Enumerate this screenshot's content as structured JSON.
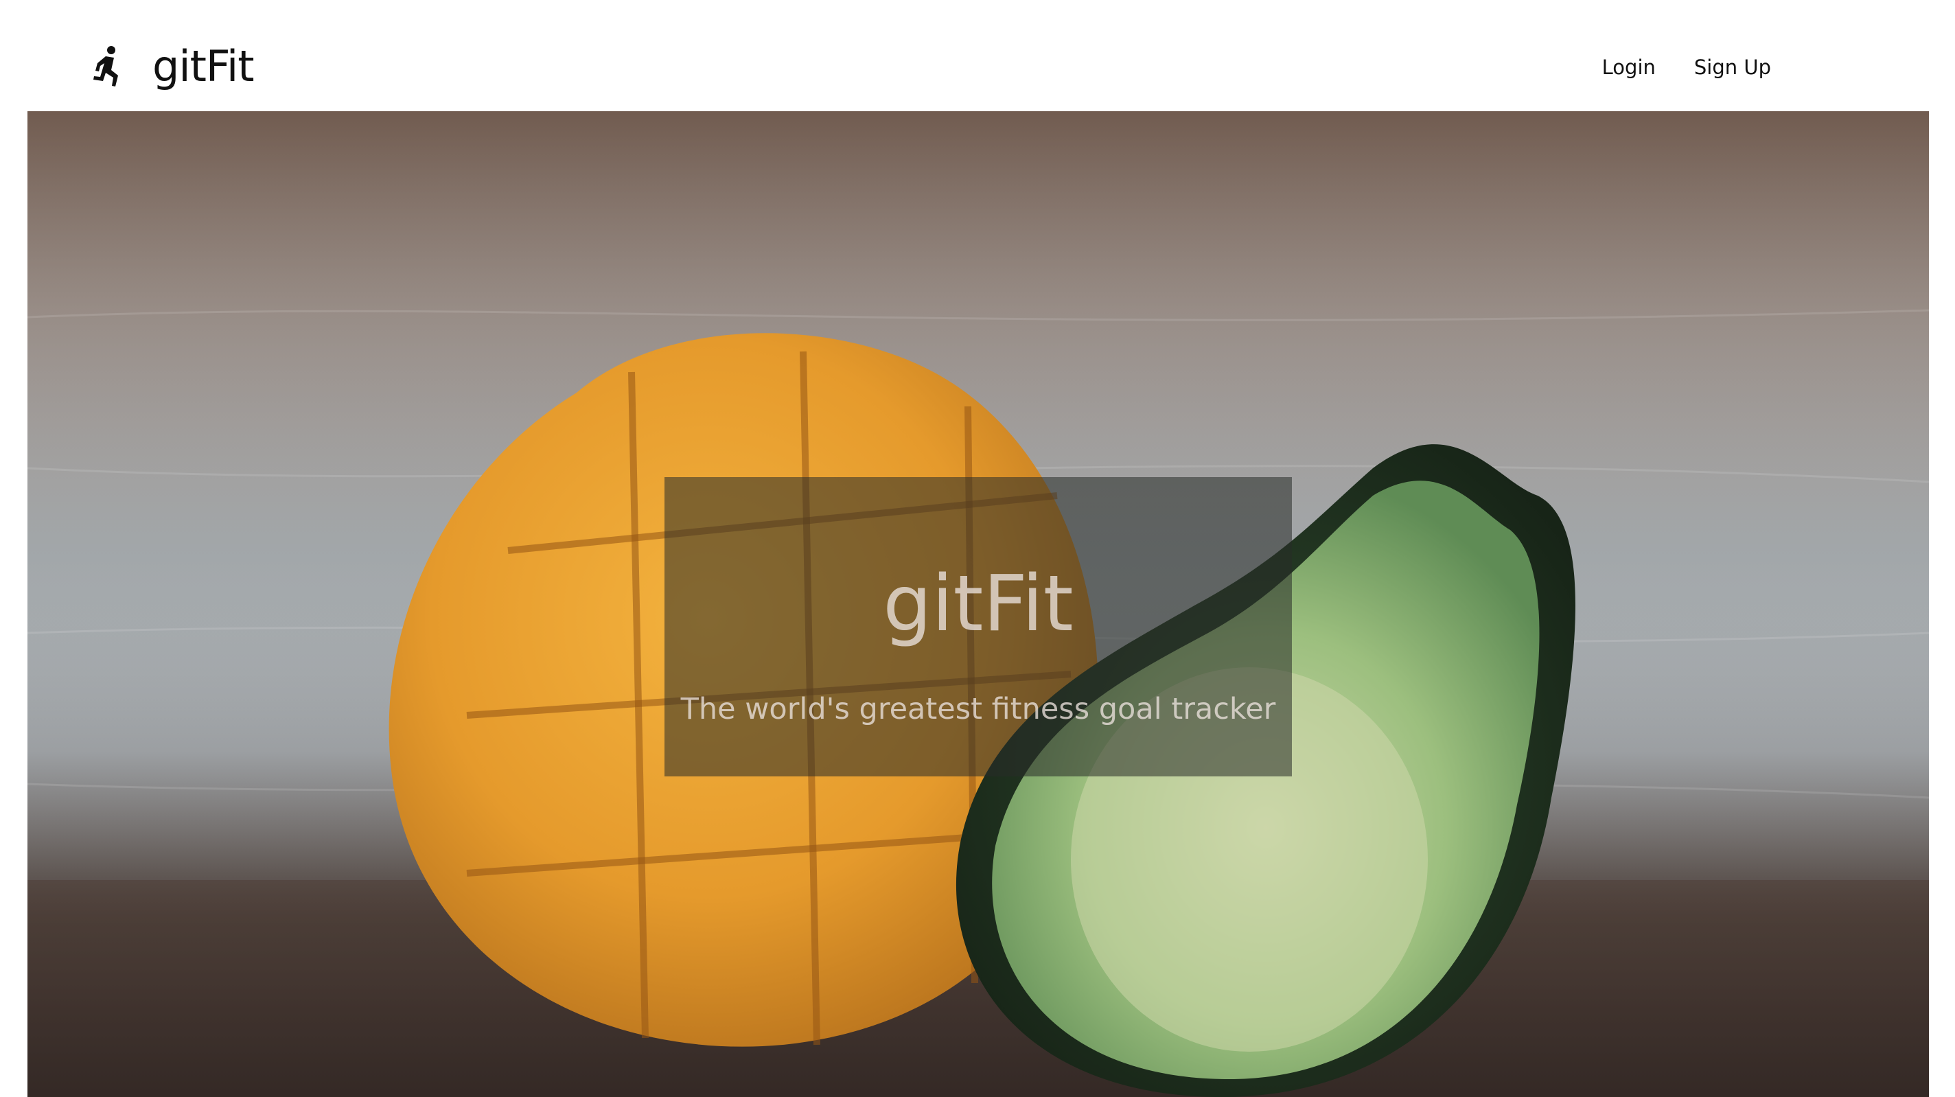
{
  "navbar": {
    "brand_icon": "running-person-icon",
    "brand_title": "gitFit",
    "links": [
      {
        "label": "Login"
      },
      {
        "label": "Sign Up"
      }
    ]
  },
  "hero": {
    "title": "gitFit",
    "subtitle": "The world's greatest fitness goal tracker"
  },
  "colors": {
    "text": "#111111",
    "overlay": "rgba(40,44,40,0.55)",
    "mango": "#e9a233",
    "avocado": "#6f9a63"
  }
}
